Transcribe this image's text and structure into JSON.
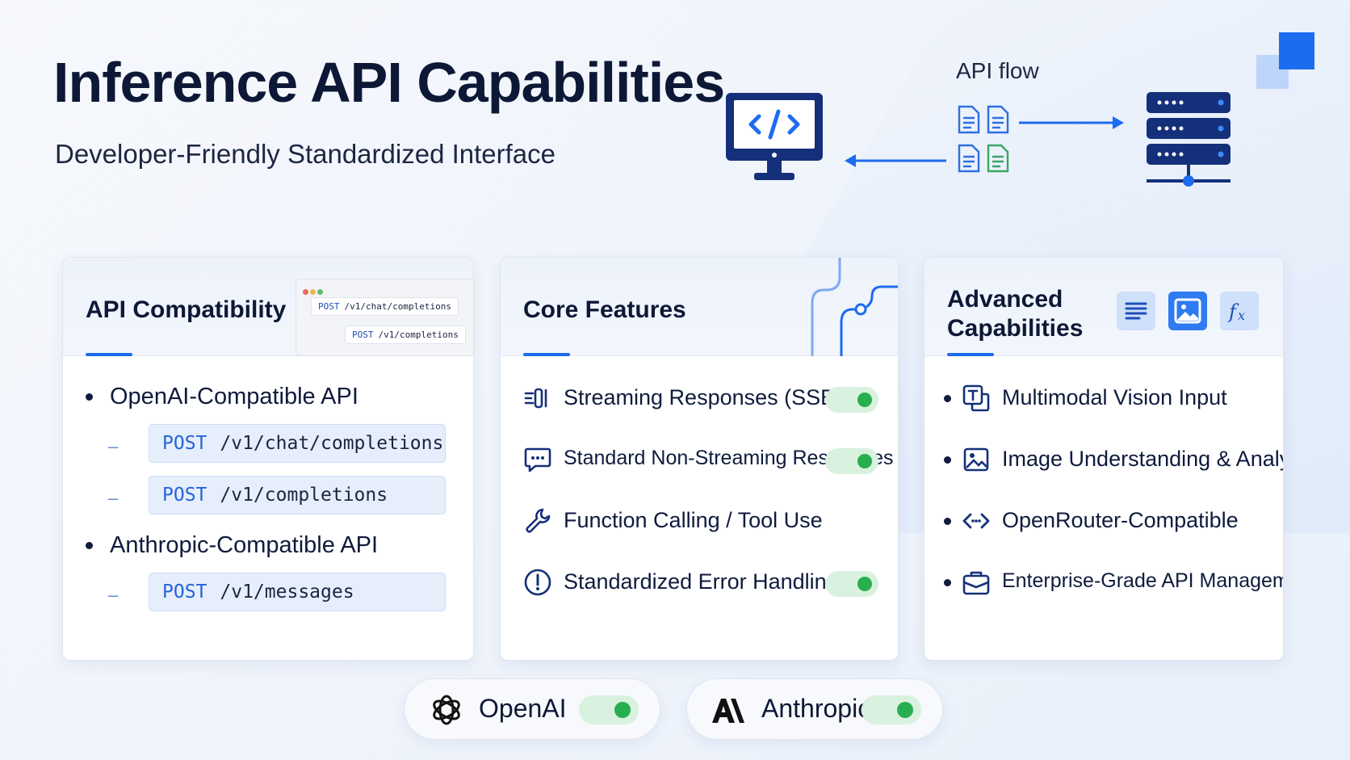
{
  "header": {
    "title": "Inference API Capabilities",
    "subtitle": "Developer-Friendly Standardized Interface"
  },
  "flow": {
    "label": "API flow",
    "client_icon": "code-monitor-icon",
    "server_icon": "server-rack-icon"
  },
  "api_compat": {
    "title": "API Compatibility",
    "preview_chips": [
      {
        "method": "POST",
        "path": "/v1/chat/completions"
      },
      {
        "method": "POST",
        "path": "/v1/completions"
      }
    ],
    "groups": [
      {
        "label": "OpenAI-Compatible API",
        "endpoints": [
          {
            "method": "POST",
            "path": "/v1/chat/completions"
          },
          {
            "method": "POST",
            "path": "/v1/completions"
          }
        ]
      },
      {
        "label": "Anthropic-Compatible API",
        "endpoints": [
          {
            "method": "POST",
            "path": "/v1/messages"
          }
        ]
      }
    ]
  },
  "core": {
    "title": "Core Features",
    "items": [
      {
        "label": "Streaming Responses (SSE)",
        "icon": "streaming-icon",
        "enabled": true
      },
      {
        "label": "Standard Non-Streaming Responses",
        "icon": "chat-bubble-icon",
        "enabled": true
      },
      {
        "label": "Function Calling / Tool Use",
        "icon": "wrench-icon",
        "enabled": false
      },
      {
        "label": "Standardized Error Handling",
        "icon": "alert-circle-icon",
        "enabled": true
      }
    ]
  },
  "advanced": {
    "title_line1": "Advanced",
    "title_line2": "Capabilities",
    "header_icons": [
      "text-lines-icon",
      "image-icon",
      "function-icon"
    ],
    "items": [
      {
        "label": "Multimodal Vision Input",
        "icon": "text-image-icon"
      },
      {
        "label": "Image Understanding & Analysis",
        "icon": "image-icon"
      },
      {
        "label": "OpenRouter-Compatible",
        "icon": "code-arrows-icon"
      },
      {
        "label": "Enterprise-Grade API Management",
        "icon": "briefcase-icon"
      }
    ]
  },
  "providers": [
    {
      "name": "OpenAI",
      "enabled": true
    },
    {
      "name": "Anthropic",
      "enabled": true
    }
  ],
  "colors": {
    "accent": "#1d6cf0",
    "toggle_on": "#27ae4f",
    "toggle_track": "#d9f1df",
    "title": "#0d1836"
  }
}
